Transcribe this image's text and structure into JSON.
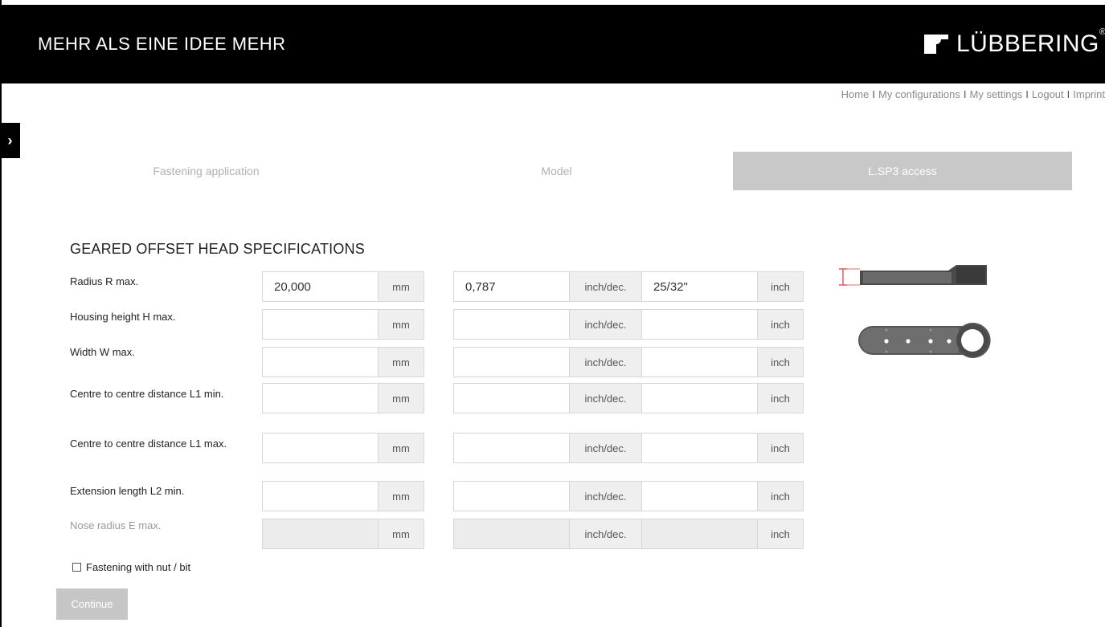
{
  "header": {
    "tagline": "MEHR ALS EINE IDEE MEHR",
    "logo_text": "LÜBBERING",
    "logo_reg": "®"
  },
  "topnav": {
    "links": [
      "Home",
      "My configurations",
      "My settings",
      "Logout",
      "Imprint"
    ],
    "separator": "I"
  },
  "sidebar_toggle": {
    "glyph": "›",
    "icon": "chevron-right-icon"
  },
  "tabs": [
    {
      "label": "Fastening application",
      "active": false
    },
    {
      "label": "Model",
      "active": false
    },
    {
      "label": "L.SP3 access",
      "active": true
    }
  ],
  "section_title": "GEARED OFFSET HEAD SPECIFICATIONS",
  "units": {
    "mm": "mm",
    "inch_dec": "inch/dec.",
    "inch": "inch"
  },
  "rows": [
    {
      "label": "Radius R max.",
      "mm": "20,000",
      "inch_dec": "0,787",
      "inch": "25/32\"",
      "disabled": false
    },
    {
      "label": "Housing height H max.",
      "mm": "",
      "inch_dec": "",
      "inch": "",
      "disabled": false
    },
    {
      "label": "Width W max.",
      "mm": "",
      "inch_dec": "",
      "inch": "",
      "disabled": false
    },
    {
      "label": "Centre to centre distance L1 min.",
      "mm": "",
      "inch_dec": "",
      "inch": "",
      "disabled": false
    },
    {
      "label": "Centre to centre distance L1 max.",
      "mm": "",
      "inch_dec": "",
      "inch": "",
      "disabled": false
    },
    {
      "label": "Extension length L2 min.",
      "mm": "",
      "inch_dec": "",
      "inch": "",
      "disabled": false
    },
    {
      "label": "Nose radius E max.",
      "mm": "",
      "inch_dec": "",
      "inch": "",
      "disabled": true
    }
  ],
  "fastening_checkbox": {
    "label": "Fastening with nut / bit",
    "checked": false
  },
  "continue_button": {
    "label": "Continue",
    "enabled": false
  },
  "colors": {
    "header_bg": "#000000",
    "tab_active_bg": "#c8c8c8",
    "dimension_marker": "#e0303a"
  }
}
